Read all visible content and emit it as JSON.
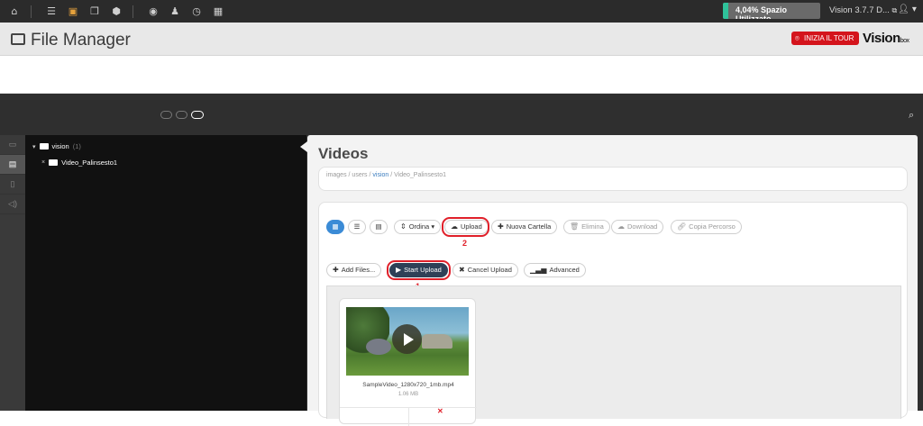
{
  "topbar": {
    "icons": [
      "home-icon",
      "list-icon",
      "image-icon",
      "windows-icon",
      "box-icon",
      "eye-icon",
      "users-icon",
      "clock-icon",
      "dashboard-icon"
    ],
    "space_text": "4,04% Spazio Utilizzato",
    "space_percent": 4.04,
    "version_text": "Vision 3.7.7 D...",
    "user_caret": "▾"
  },
  "header": {
    "title": "File Manager",
    "tour_button": "INIZIA IL TOUR",
    "brand": "Vision",
    "brand_suffix": "box"
  },
  "tree": {
    "root_label": "vision",
    "root_count": "(1)",
    "child_label": "Video_Palinsesto1"
  },
  "main": {
    "title": "Videos",
    "breadcrumb": [
      "images",
      "users",
      "vision",
      "Video_Palinsesto1"
    ],
    "breadcrumb_active_index": 2
  },
  "toolbar": {
    "ordina": "Ordina",
    "upload": "Upload",
    "new_folder": "Nuova Cartella",
    "delete": "Elimina",
    "download": "Download",
    "copy_path": "Copia Percorso",
    "marker_2": "2"
  },
  "upload_bar": {
    "add_files": "Add Files...",
    "start_upload": "Start Upload",
    "cancel_upload": "Cancel Upload",
    "advanced": "Advanced",
    "marker_1": "1"
  },
  "files": [
    {
      "name": "SampleVideo_1280x720_1mb.mp4",
      "size": "1.06 MB"
    }
  ],
  "colors": {
    "accent": "#3b8bd6",
    "dark_button": "#2e4057",
    "highlight": "#e0202a",
    "space_fill": "#2fc29a",
    "tour": "#d4141c"
  }
}
